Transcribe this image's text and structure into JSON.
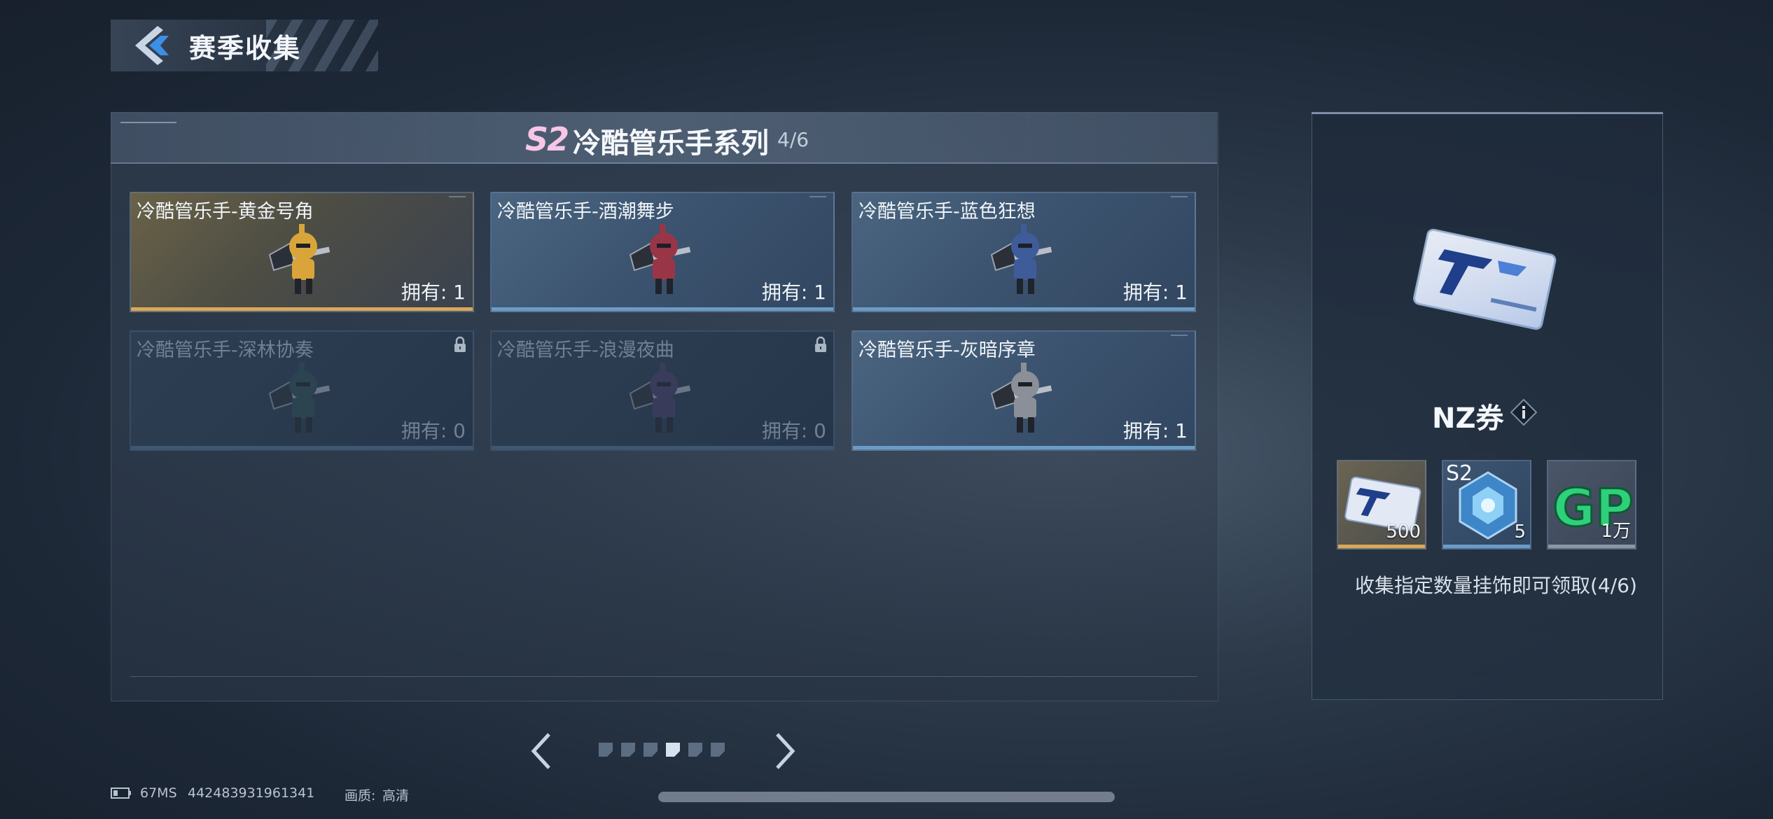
{
  "header": {
    "title": "赛季收集"
  },
  "series": {
    "badge": "S2",
    "title": "冷酷管乐手系列",
    "progress": "4/6"
  },
  "cards": [
    {
      "name": "冷酷管乐手-黄金号角",
      "owned": "拥有: 1",
      "locked": false,
      "tier": "gold",
      "figure_color": "#d9a53a"
    },
    {
      "name": "冷酷管乐手-酒潮舞步",
      "owned": "拥有: 1",
      "locked": false,
      "tier": "blue",
      "figure_color": "#9a3548"
    },
    {
      "name": "冷酷管乐手-蓝色狂想",
      "owned": "拥有: 1",
      "locked": false,
      "tier": "blue",
      "figure_color": "#3f5c9a"
    },
    {
      "name": "冷酷管乐手-深林协奏",
      "owned": "拥有: 0",
      "locked": true,
      "tier": "locked",
      "figure_color": "#2f4f54"
    },
    {
      "name": "冷酷管乐手-浪漫夜曲",
      "owned": "拥有: 0",
      "locked": true,
      "tier": "locked",
      "figure_color": "#4a3f6a"
    },
    {
      "name": "冷酷管乐手-灰暗序章",
      "owned": "拥有: 1",
      "locked": false,
      "tier": "blue",
      "figure_color": "#8a8f98"
    }
  ],
  "reward": {
    "name": "NZ券",
    "items": [
      {
        "qty": "500",
        "icon": "nz-ticket-icon",
        "bar_color": "#d9a85a"
      },
      {
        "label": "S2",
        "qty": "5",
        "icon": "s2-crystal-icon",
        "bar_color": "#6b9cc8"
      },
      {
        "qty": "1万",
        "icon": "gp-coin-icon",
        "bar_color": "#8d97a4"
      }
    ],
    "hint": "收集指定数量挂饰即可领取(4/6)"
  },
  "pagination": {
    "total": 6,
    "current_index": 3
  },
  "status": {
    "ping": "67MS",
    "id": "442483931961341",
    "quality_label": "画质:",
    "quality": "高清"
  },
  "colors": {
    "accent_gold": "#d9a85a",
    "accent_blue": "#6b9cc8",
    "badge_pink": "#f7c6e6"
  }
}
